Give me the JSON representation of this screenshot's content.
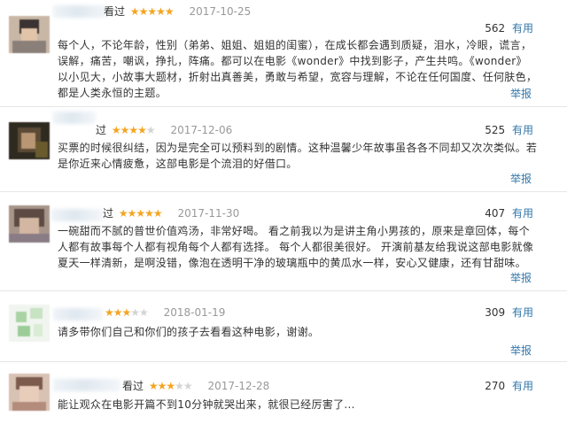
{
  "reviews": [
    {
      "watched": "看过",
      "rating": 5,
      "date": "2017-10-25",
      "votes": "562",
      "useful_label": "有用",
      "content": "每个人，不论年龄，性别（弟弟、姐姐、姐姐的闺蜜），在成长都会遇到质疑，泪水，冷眼，谎言，误解，痛苦，嘲讽，挣扎，阵痛。都可以在电影《wonder》中找到影子，产生共鸣。《wonder》以小见大，小故事大题材，折射出真善美，勇敢与希望，宽容与理解，不论在任何国度、任何肤色，都是人类永恒的主题。",
      "report": "举报"
    },
    {
      "watched": "过",
      "rating": 4,
      "date": "2017-12-06",
      "votes": "525",
      "useful_label": "有用",
      "content": "买票的时候很纠结，因为是完全可以预料到的剧情。这种温馨少年故事虽各各不同却又次次类似。若是你近来心情疲惫，这部电影是个流泪的好借口。",
      "report": "举报"
    },
    {
      "watched": "过",
      "rating": 5,
      "date": "2017-11-30",
      "votes": "407",
      "useful_label": "有用",
      "content": "一碗甜而不腻的普世价值鸡汤，非常好喝。 看之前我以为是讲主角小男孩的，原来是章回体，每个人都有故事每个人都有视角每个人都有选择。 每个人都很美很好。 开演前基友给我说这部电影就像夏天一样清新，是啊没错，像泡在透明干净的玻璃瓶中的黄瓜水一样，安心又健康，还有甘甜味。",
      "report": "举报"
    },
    {
      "watched": "",
      "rating": 3,
      "date": "2018-01-19",
      "votes": "309",
      "useful_label": "有用",
      "content": "请多带你们自己和你们的孩子去看看这种电影，谢谢。",
      "report": "举报"
    },
    {
      "watched": "看过",
      "rating": 3,
      "date": "2017-12-28",
      "votes": "270",
      "useful_label": "有用",
      "content": "能让观众在电影开篇不到10分钟就哭出来，就很已经厉害了...",
      "report": ""
    }
  ],
  "colors": {
    "star_on": "#f4a522",
    "star_off": "#d4d4d4",
    "link": "#3377aa",
    "date": "#999999",
    "text": "#333333"
  },
  "icons": {
    "avatar": "blurred-user-avatar",
    "star": "star-icon"
  }
}
